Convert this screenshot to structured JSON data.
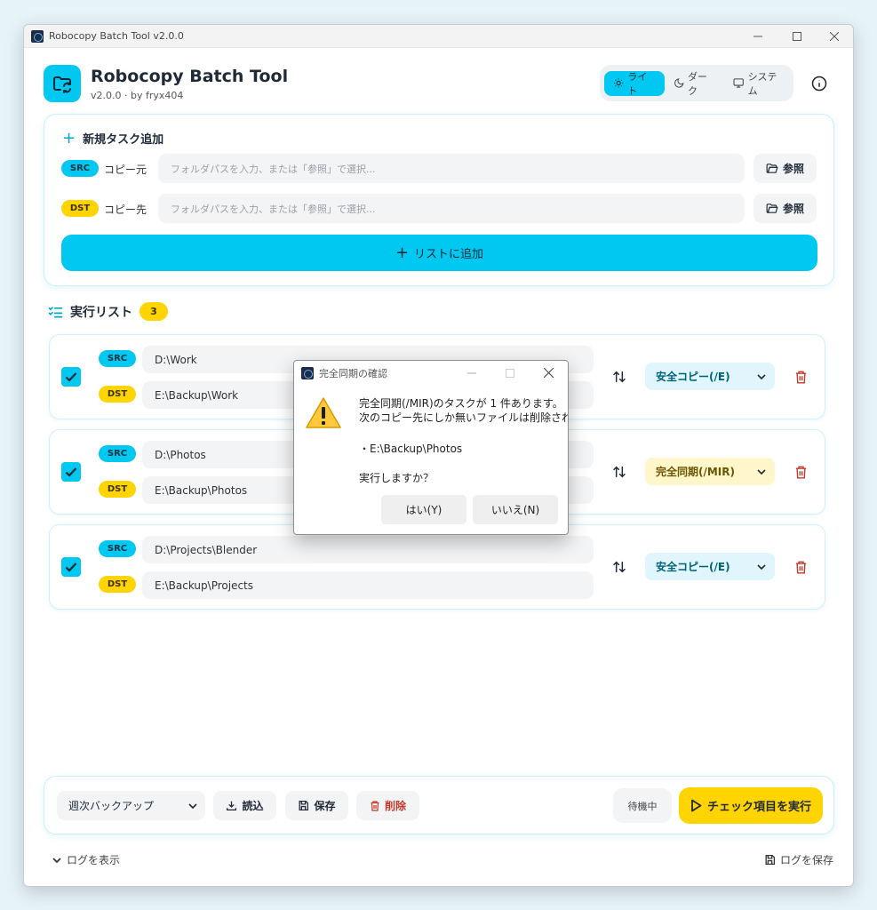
{
  "window": {
    "title": "Robocopy Batch Tool  v2.0.0"
  },
  "header": {
    "app_name": "Robocopy Batch Tool",
    "subtitle": "v2.0.0  ·  by fryx404",
    "theme": {
      "light": "ライト",
      "dark": "ダーク",
      "system": "システム",
      "selected": "light"
    }
  },
  "add_task": {
    "title": "新規タスク追加",
    "src_badge": "SRC",
    "src_label": "コピー元",
    "src_placeholder": "フォルダパスを入力、または「参照」で選択...",
    "dst_badge": "DST",
    "dst_label": "コピー先",
    "dst_placeholder": "フォルダパスを入力、または「参照」で選択...",
    "browse_label": "参照",
    "add_button": "リストに追加"
  },
  "task_list": {
    "title": "実行リスト",
    "count": "3",
    "items": [
      {
        "src_badge": "SRC",
        "dst_badge": "DST",
        "src": "D:\\Work",
        "dst": "E:\\Backup\\Work",
        "mode": "安全コピー(/E)",
        "mode_kind": "e",
        "checked": true
      },
      {
        "src_badge": "SRC",
        "dst_badge": "DST",
        "src": "D:\\Photos",
        "dst": "E:\\Backup\\Photos",
        "mode": "完全同期(/MIR)",
        "mode_kind": "mir",
        "checked": true
      },
      {
        "src_badge": "SRC",
        "dst_badge": "DST",
        "src": "D:\\Projects\\Blender",
        "dst": "E:\\Backup\\Projects",
        "mode": "安全コピー(/E)",
        "mode_kind": "e",
        "checked": true
      }
    ]
  },
  "bottom_bar": {
    "preset": "週次バックアップ",
    "load": "読込",
    "save": "保存",
    "delete": "削除",
    "status": "待機中",
    "run": "チェック項目を実行"
  },
  "footer": {
    "show_log": "ログを表示",
    "save_log": "ログを保存"
  },
  "dialog": {
    "title": "完全同期の確認",
    "line1": "完全同期(/MIR)のタスクが 1 件あります。",
    "line2": "次のコピー先にしか無いファイルは削除されます。",
    "path": "・E:\\Backup\\Photos",
    "question": "実行しますか？",
    "yes": "はい(Y)",
    "no": "いいえ(N)"
  },
  "colors": {
    "accent": "#00c8f0",
    "warning": "#ffd400",
    "danger": "#c0392b"
  }
}
